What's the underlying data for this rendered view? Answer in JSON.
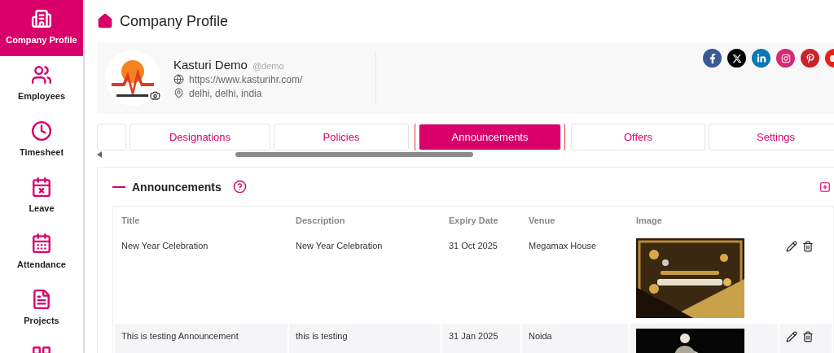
{
  "sidebar": {
    "items": [
      {
        "label": "Company Profile",
        "selected": true
      },
      {
        "label": "Employees",
        "selected": false
      },
      {
        "label": "Timesheet",
        "selected": false
      },
      {
        "label": "Leave",
        "selected": false
      },
      {
        "label": "Attendance",
        "selected": false
      },
      {
        "label": "Projects",
        "selected": false
      },
      {
        "selected": false
      }
    ]
  },
  "page_title": "Company Profile",
  "profile": {
    "name": "Kasturi Demo",
    "handle": "@demo",
    "website": "https://www.kasturihr.com/",
    "location": "delhi, delhi, india"
  },
  "tabs": [
    {
      "selected": false
    },
    {
      "label": "Designations",
      "selected": false
    },
    {
      "label": "Policies",
      "selected": false
    },
    {
      "label": "Announcements",
      "selected": true
    },
    {
      "label": "Offers",
      "selected": false
    },
    {
      "label": "Settings",
      "selected": false
    }
  ],
  "section": {
    "title": "Announcements"
  },
  "table": {
    "columns": [
      "Title",
      "Description",
      "Expiry Date",
      "Venue",
      "Image"
    ],
    "rows": [
      {
        "title": "New Year Celebration",
        "description": "New Year Celebration",
        "expiry_date": "31 Oct 2025",
        "venue": "Megamax House"
      },
      {
        "title": "This is testing Announcement",
        "description": "this is testing",
        "expiry_date": "31 Jan 2025",
        "venue": "Noida"
      }
    ]
  }
}
